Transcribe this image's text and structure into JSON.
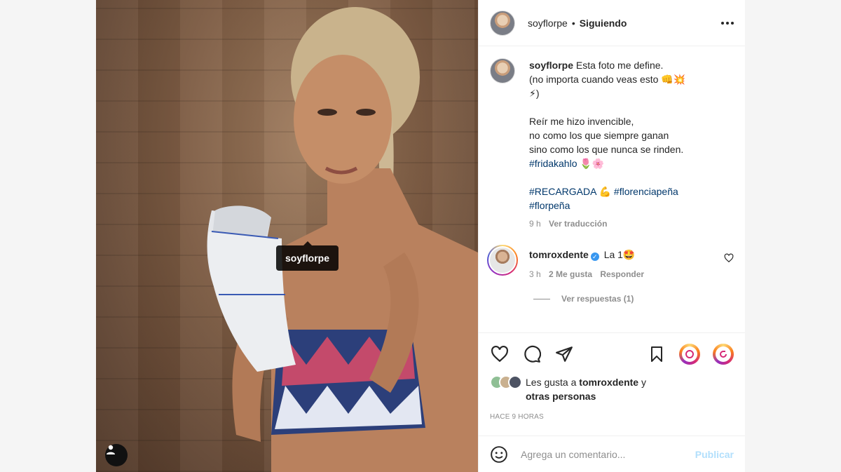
{
  "photo": {
    "tag_label": "soyflorpe"
  },
  "header": {
    "username": "soyflorpe",
    "separator": "•",
    "follow_state": "Siguiendo"
  },
  "caption": {
    "username": "soyflorpe",
    "line1": "Esta foto me define.",
    "line2": "(no importa cuando veas esto 👊💥",
    "line3": "⚡)",
    "line4": "Reír me hizo invencible,",
    "line5": "no como los que siempre ganan",
    "line6": "sino como los que nunca se rinden.",
    "hashtag_frida": "#fridakahlo",
    "emoji_frida": "🌷🌸",
    "hashtag_recargada": "#RECARGADA",
    "emoji_muscle": "💪",
    "hashtag_florencia": "#florenciapeña",
    "hashtag_florpena": "#florpeña",
    "time": "9 h",
    "translate": "Ver traducción"
  },
  "comment": {
    "username": "tomroxdente",
    "verified_mark": "✓",
    "text": "La 1🤩",
    "time": "3 h",
    "likes": "2 Me gusta",
    "reply": "Responder",
    "view_replies": "Ver respuestas (1)"
  },
  "likes": {
    "prefix": "Les gusta a",
    "user": "tomroxdente",
    "conj": "y",
    "others": "otras personas"
  },
  "timestamp": "HACE 9 HORAS",
  "add_comment": {
    "placeholder": "Agrega un comentario...",
    "publish": "Publicar"
  },
  "colors": {
    "link": "#00376b",
    "muted": "#8e8e8e",
    "publish_disabled": "#b2dffc",
    "verified": "#3897f0"
  },
  "icons": [
    "heart-icon",
    "comment-icon",
    "share-icon",
    "bookmark-icon",
    "story-share-icon",
    "story-reshare-icon",
    "emoji-icon",
    "more-icon",
    "user-tag-icon"
  ]
}
